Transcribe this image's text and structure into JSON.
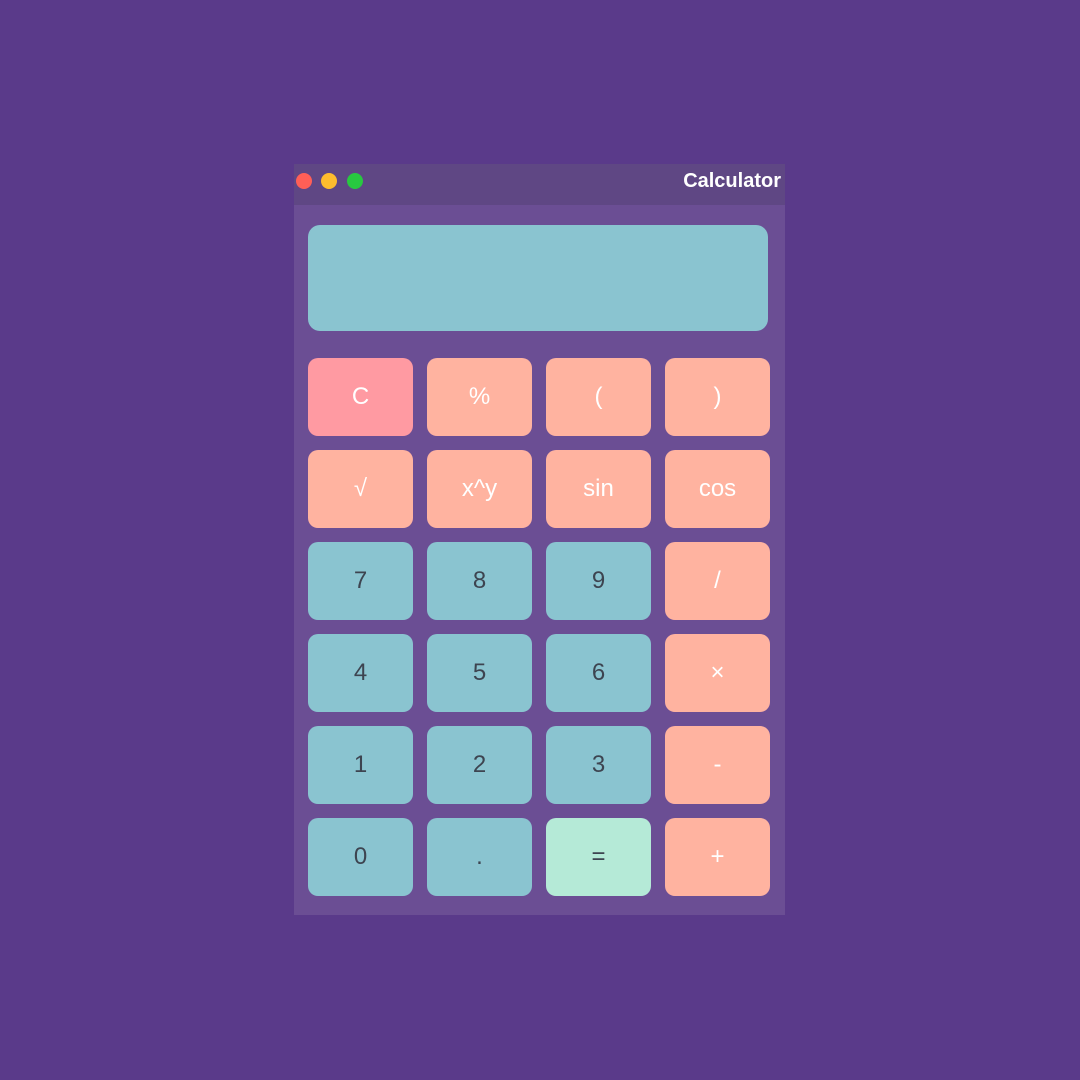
{
  "window": {
    "title": "Calculator"
  },
  "display": {
    "value": ""
  },
  "keys": {
    "clear": "C",
    "percent": "%",
    "open_paren": "(",
    "close_paren": ")",
    "sqrt": "√",
    "power": "x^y",
    "sin": "sin",
    "cos": "cos",
    "seven": "7",
    "eight": "8",
    "nine": "9",
    "divide": "/",
    "four": "4",
    "five": "5",
    "six": "6",
    "multiply": "×",
    "one": "1",
    "two": "2",
    "three": "3",
    "subtract": "-",
    "zero": "0",
    "decimal": ".",
    "equals": "=",
    "add": "+"
  },
  "colors": {
    "background": "#5a3a8a",
    "window": "#6b4e94",
    "titlebar": "#5f4784",
    "number_key": "#8ac4d0",
    "operator_key": "#ffb3a0",
    "clear_key": "#ff9aa2",
    "equals_key": "#b5ead7"
  }
}
